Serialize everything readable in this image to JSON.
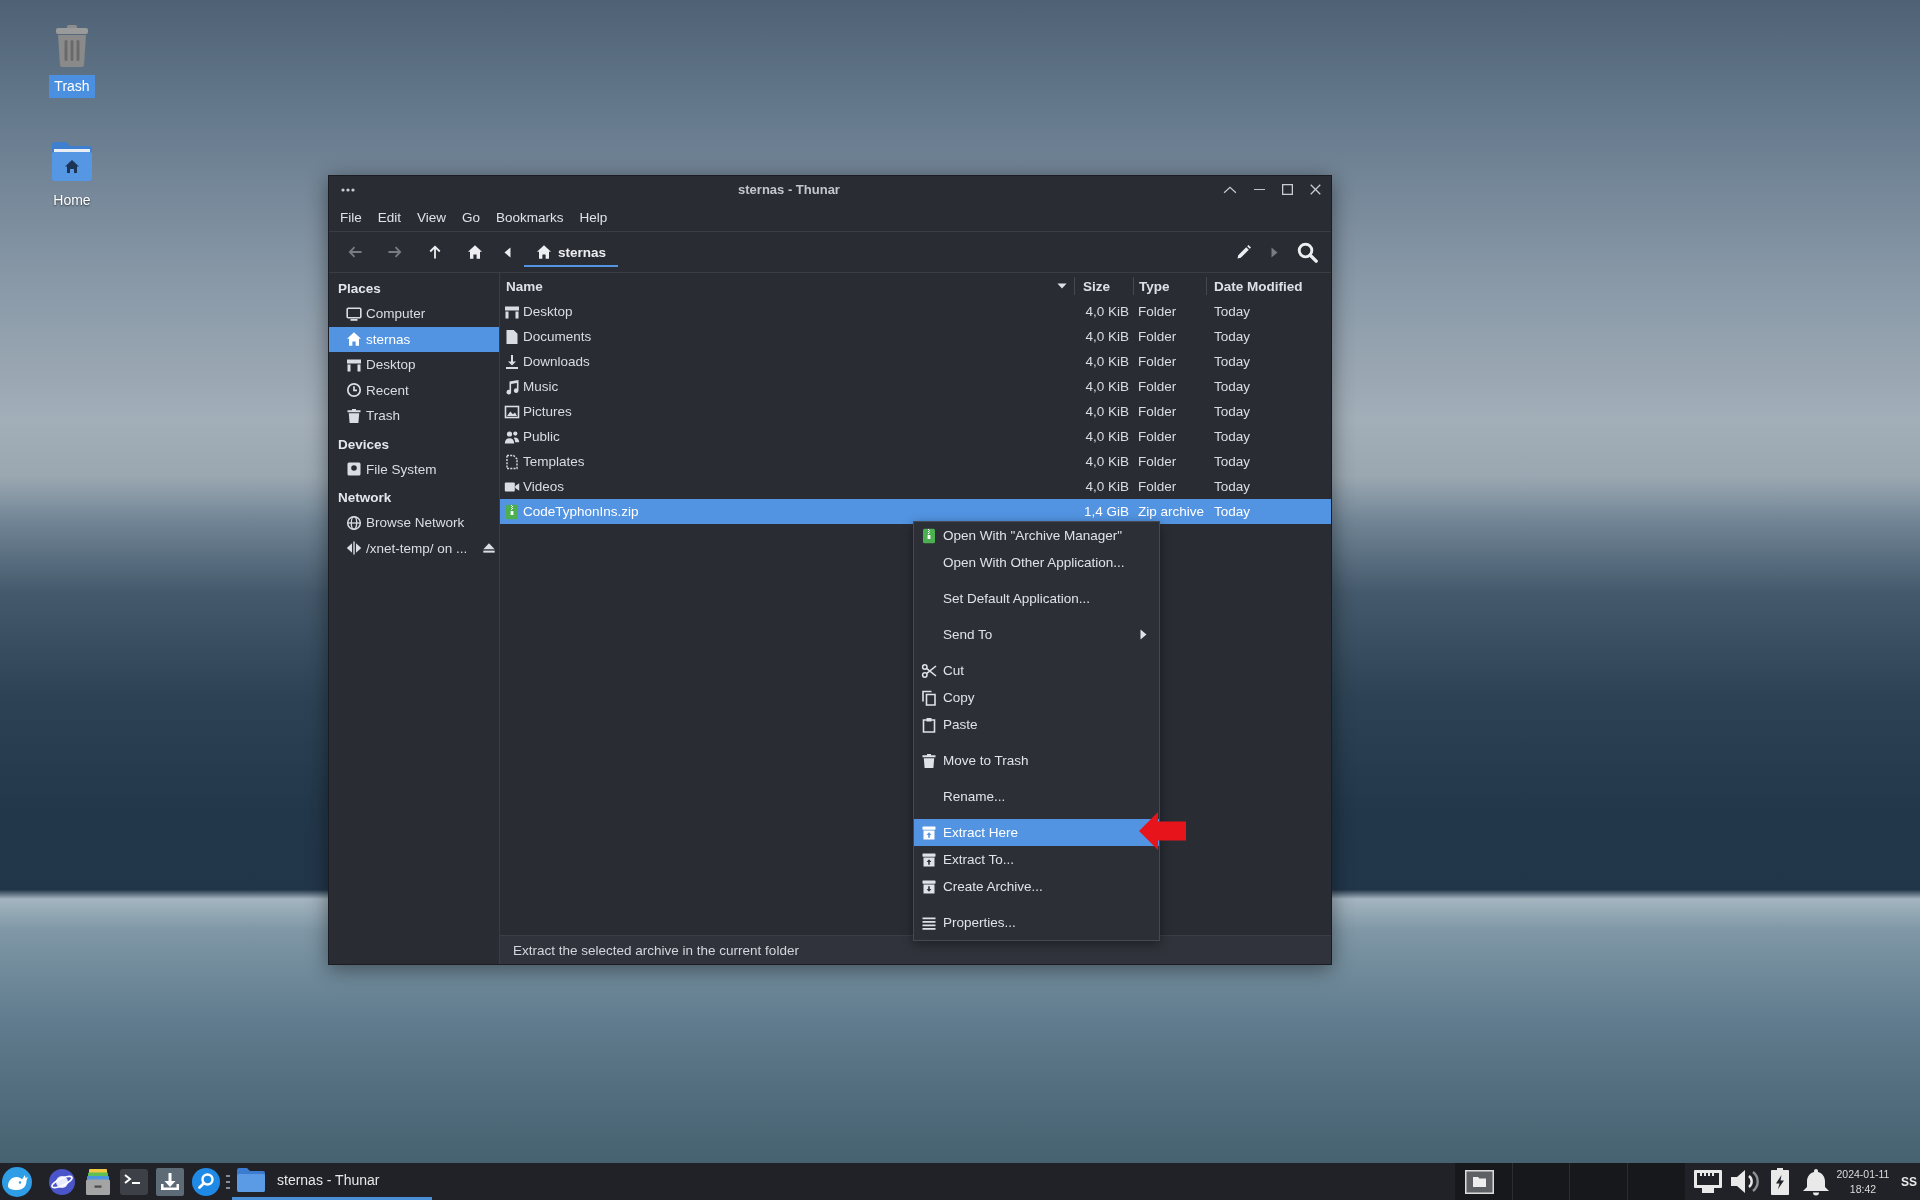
{
  "desktop": {
    "icons": [
      {
        "label": "Trash",
        "selected": true
      },
      {
        "label": "Home",
        "selected": false
      }
    ]
  },
  "window": {
    "title": "sternas - Thunar"
  },
  "menu_bar": [
    "File",
    "Edit",
    "View",
    "Go",
    "Bookmarks",
    "Help"
  ],
  "toolbar": {
    "nav_buttons": [
      {
        "disabled": true
      },
      {
        "disabled": true
      },
      {
        "disabled": false
      },
      {
        "disabled": false
      }
    ],
    "path_scroll_left": {
      "disabled": false
    },
    "path": [
      {
        "label": "sternas",
        "selected": true
      }
    ],
    "path_scroll_right": {
      "disabled": true
    }
  },
  "sidebar": {
    "sections": [
      {
        "title": "Places",
        "items": [
          {
            "label": "Computer",
            "selected": false,
            "eject": false
          },
          {
            "label": "sternas",
            "selected": true,
            "eject": false
          },
          {
            "label": "Desktop",
            "selected": false,
            "eject": false
          },
          {
            "label": "Recent",
            "selected": false,
            "eject": false
          },
          {
            "label": "Trash",
            "selected": false,
            "eject": false
          }
        ]
      },
      {
        "title": "Devices",
        "items": [
          {
            "label": "File System",
            "selected": false,
            "eject": false
          }
        ]
      },
      {
        "title": "Network",
        "items": [
          {
            "label": "Browse Network",
            "selected": false,
            "eject": false
          },
          {
            "label": "/xnet-temp/ on ...",
            "selected": false,
            "eject": true
          }
        ]
      }
    ]
  },
  "file_list": {
    "columns": [
      {
        "label": "Name",
        "sorted": true
      },
      {
        "label": "Size",
        "sorted": false
      },
      {
        "label": "Type",
        "sorted": false
      },
      {
        "label": "Date Modified",
        "sorted": false
      }
    ],
    "rows": [
      {
        "name": "Desktop",
        "size": "4,0 KiB",
        "type": "Folder",
        "modified": "Today",
        "selected": false
      },
      {
        "name": "Documents",
        "size": "4,0 KiB",
        "type": "Folder",
        "modified": "Today",
        "selected": false
      },
      {
        "name": "Downloads",
        "size": "4,0 KiB",
        "type": "Folder",
        "modified": "Today",
        "selected": false
      },
      {
        "name": "Music",
        "size": "4,0 KiB",
        "type": "Folder",
        "modified": "Today",
        "selected": false
      },
      {
        "name": "Pictures",
        "size": "4,0 KiB",
        "type": "Folder",
        "modified": "Today",
        "selected": false
      },
      {
        "name": "Public",
        "size": "4,0 KiB",
        "type": "Folder",
        "modified": "Today",
        "selected": false
      },
      {
        "name": "Templates",
        "size": "4,0 KiB",
        "type": "Folder",
        "modified": "Today",
        "selected": false
      },
      {
        "name": "Videos",
        "size": "4,0 KiB",
        "type": "Folder",
        "modified": "Today",
        "selected": false
      },
      {
        "name": "CodeTyphonIns.zip",
        "size": "1,4 GiB",
        "type": "Zip archive",
        "modified": "Today",
        "selected": true
      }
    ]
  },
  "context_menu": {
    "items": [
      {
        "kind": "item",
        "label": "Open With \"Archive Manager\"",
        "selected": false,
        "submenu": false
      },
      {
        "kind": "item",
        "label": "Open With Other Application...",
        "selected": false,
        "submenu": false
      },
      {
        "kind": "separator"
      },
      {
        "kind": "item",
        "label": "Set Default Application...",
        "selected": false,
        "submenu": false
      },
      {
        "kind": "separator"
      },
      {
        "kind": "item",
        "label": "Send To",
        "selected": false,
        "submenu": true
      },
      {
        "kind": "separator"
      },
      {
        "kind": "item",
        "label": "Cut",
        "selected": false,
        "submenu": false
      },
      {
        "kind": "item",
        "label": "Copy",
        "selected": false,
        "submenu": false
      },
      {
        "kind": "item",
        "label": "Paste",
        "selected": false,
        "submenu": false
      },
      {
        "kind": "separator"
      },
      {
        "kind": "item",
        "label": "Move to Trash",
        "selected": false,
        "submenu": false
      },
      {
        "kind": "separator"
      },
      {
        "kind": "item",
        "label": "Rename...",
        "selected": false,
        "submenu": false
      },
      {
        "kind": "separator"
      },
      {
        "kind": "item",
        "label": "Extract Here",
        "selected": true,
        "submenu": false
      },
      {
        "kind": "item",
        "label": "Extract To...",
        "selected": false,
        "submenu": false
      },
      {
        "kind": "item",
        "label": "Create Archive...",
        "selected": false,
        "submenu": false
      },
      {
        "kind": "separator"
      },
      {
        "kind": "item",
        "label": "Properties...",
        "selected": false,
        "submenu": false
      }
    ]
  },
  "status_bar": {
    "text": "Extract the selected archive in the current folder"
  },
  "taskbar": {
    "tasks": [
      {
        "label": "sternas - Thunar",
        "selected": true
      }
    ],
    "workspaces": [
      {
        "has_window": true
      },
      {
        "has_window": false
      },
      {
        "has_window": false
      },
      {
        "has_window": false
      }
    ],
    "clock": {
      "date": "2024-01-11",
      "time": "18:42"
    },
    "user": "SS"
  }
}
